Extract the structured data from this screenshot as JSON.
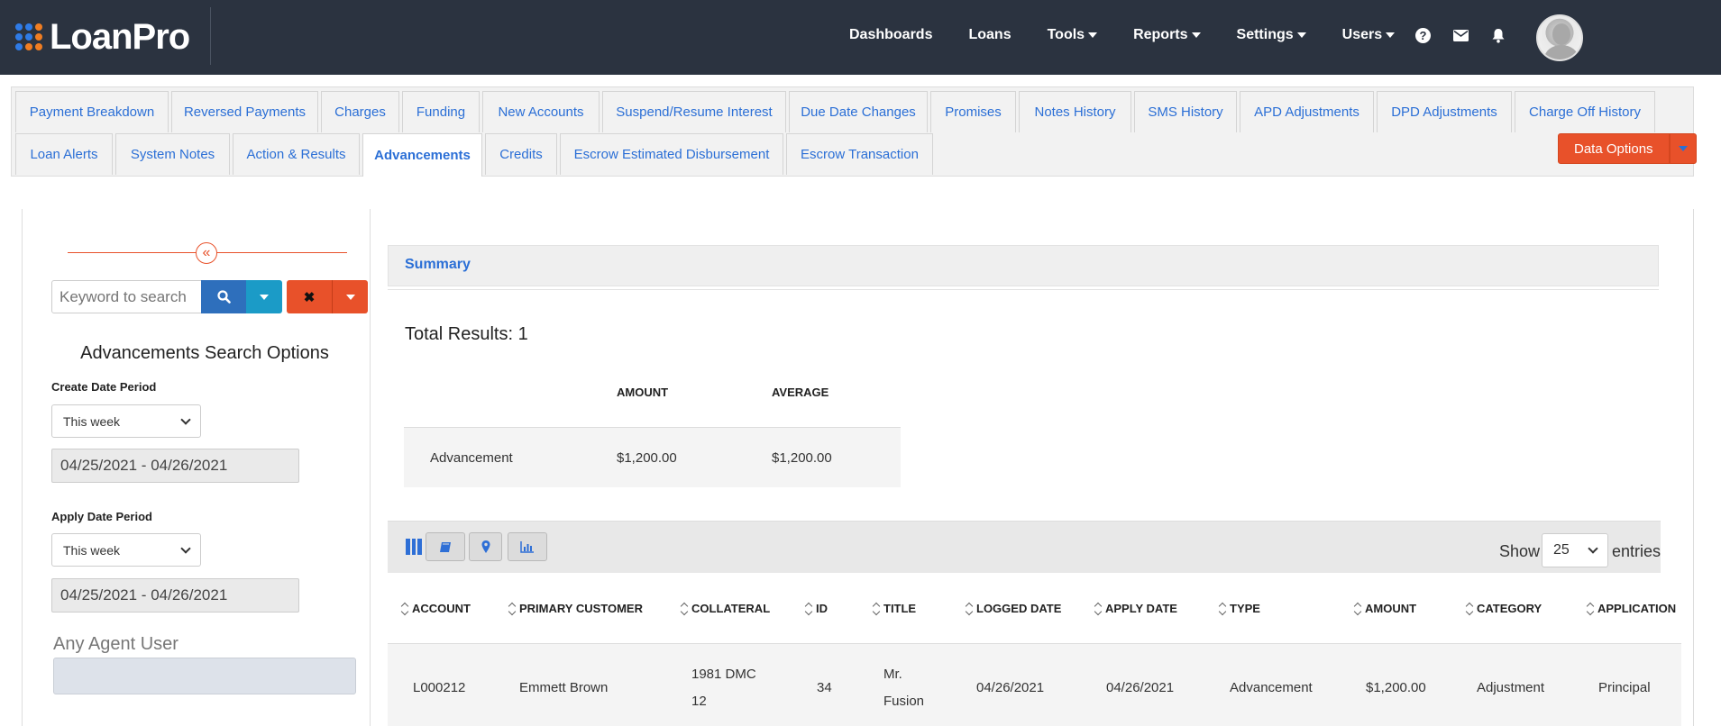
{
  "brand": {
    "name": "LoanPro"
  },
  "nav": {
    "items": [
      {
        "label": "Dashboards",
        "dropdown": false
      },
      {
        "label": "Loans",
        "dropdown": false
      },
      {
        "label": "Tools",
        "dropdown": true
      },
      {
        "label": "Reports",
        "dropdown": true
      },
      {
        "label": "Settings",
        "dropdown": true
      },
      {
        "label": "Users",
        "dropdown": true
      }
    ],
    "icons": [
      "help-icon",
      "mail-icon",
      "bell-icon"
    ]
  },
  "tabs": {
    "row1": [
      "Payment Breakdown",
      "Reversed Payments",
      "Charges",
      "Funding",
      "New Accounts",
      "Suspend/Resume Interest",
      "Due Date Changes",
      "Promises",
      "Notes History",
      "SMS History",
      "APD Adjustments",
      "DPD Adjustments",
      "Charge Off History"
    ],
    "row2": [
      "Loan Alerts",
      "System Notes",
      "Action & Results",
      "Advancements",
      "Credits",
      "Escrow Estimated Disbursement",
      "Escrow Transaction"
    ],
    "active": "Advancements",
    "data_options_label": "Data Options"
  },
  "search": {
    "placeholder": "Keyword to search",
    "title": "Advancements Search Options",
    "create_label": "Create Date Period",
    "create_value": "This week",
    "create_range": "04/25/2021 - 04/26/2021",
    "apply_label": "Apply Date Period",
    "apply_value": "This week",
    "apply_range": "04/25/2021 - 04/26/2021",
    "agent_label": "Any Agent User"
  },
  "summary": {
    "label": "Summary",
    "total_results": "Total Results: 1",
    "headers": {
      "amount": "AMOUNT",
      "average": "AVERAGE"
    },
    "row": {
      "type": "Advancement",
      "amount": "$1,200.00",
      "average": "$1,200.00"
    }
  },
  "table": {
    "show_label": "Show",
    "page_size": "25",
    "entries_label": "entries",
    "columns": [
      "ACCOUNT",
      "PRIMARY CUSTOMER",
      "COLLATERAL",
      "ID",
      "TITLE",
      "LOGGED DATE",
      "APPLY DATE",
      "TYPE",
      "AMOUNT",
      "CATEGORY",
      "APPLICATION"
    ],
    "rows": [
      {
        "account": "L000212",
        "customer": "Emmett Brown",
        "collateral_1": "1981 DMC",
        "collateral_2": "12",
        "id": "34",
        "title_1": "Mr.",
        "title_2": "Fusion",
        "logged_date": "04/26/2021",
        "apply_date": "04/26/2021",
        "type": "Advancement",
        "amount": "$1,200.00",
        "category": "Adjustment",
        "application": "Principal"
      }
    ]
  },
  "colors": {
    "topbar": "#2b3340",
    "link": "#2b6fd6",
    "accent_orange": "#e8512a",
    "search_blue": "#2e6fbc",
    "search_teal": "#1b9bc7"
  }
}
